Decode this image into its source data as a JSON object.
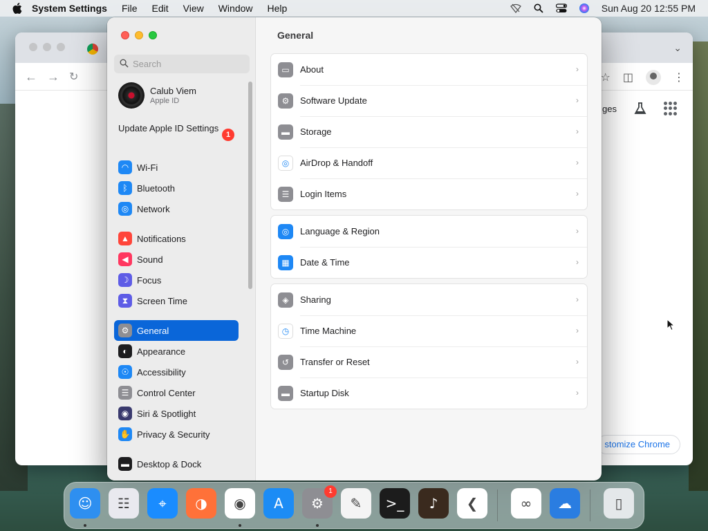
{
  "menubar": {
    "app_name": "System Settings",
    "items": [
      "File",
      "Edit",
      "View",
      "Window",
      "Help"
    ],
    "clock": "Sun Aug 20  12:55 PM",
    "status_icons": [
      "wifi-off-icon",
      "search-icon",
      "control-center-icon",
      "siri-icon"
    ]
  },
  "chrome": {
    "images_link": "ges",
    "customize_label": "stomize Chrome"
  },
  "settings": {
    "search_placeholder": "Search",
    "account": {
      "name": "Calub Viem",
      "sub": "Apple ID"
    },
    "update": {
      "label": "Update Apple ID Settings",
      "badge": "1"
    },
    "sidebar_groups": [
      [
        {
          "label": "Wi-Fi",
          "icon": "wifi-icon",
          "color": "#1e88f5"
        },
        {
          "label": "Bluetooth",
          "icon": "bluetooth-icon",
          "color": "#1e88f5"
        },
        {
          "label": "Network",
          "icon": "globe-icon",
          "color": "#1e88f5"
        }
      ],
      [
        {
          "label": "Notifications",
          "icon": "bell-icon",
          "color": "#ff453a"
        },
        {
          "label": "Sound",
          "icon": "speaker-icon",
          "color": "#ff375f"
        },
        {
          "label": "Focus",
          "icon": "moon-icon",
          "color": "#5e5ce6"
        },
        {
          "label": "Screen Time",
          "icon": "hourglass-icon",
          "color": "#5e5ce6"
        }
      ],
      [
        {
          "label": "General",
          "icon": "gear-icon",
          "color": "#8e8e93",
          "active": true
        },
        {
          "label": "Appearance",
          "icon": "appearance-icon",
          "color": "#1c1c1e"
        },
        {
          "label": "Accessibility",
          "icon": "accessibility-icon",
          "color": "#1e88f5"
        },
        {
          "label": "Control Center",
          "icon": "control-center-icon",
          "color": "#8e8e93"
        },
        {
          "label": "Siri & Spotlight",
          "icon": "siri-icon",
          "color": "#3a3a6e"
        },
        {
          "label": "Privacy & Security",
          "icon": "hand-icon",
          "color": "#1e88f5"
        }
      ],
      [
        {
          "label": "Desktop & Dock",
          "icon": "dock-icon",
          "color": "#1c1c1e"
        }
      ]
    ],
    "content_title": "General",
    "groups": [
      [
        {
          "label": "About",
          "icon": "computer-icon",
          "color": "#8e8e93"
        },
        {
          "label": "Software Update",
          "icon": "gear-badge-icon",
          "color": "#8e8e93"
        },
        {
          "label": "Storage",
          "icon": "drive-icon",
          "color": "#8e8e93"
        },
        {
          "label": "AirDrop & Handoff",
          "icon": "airdrop-icon",
          "color": "#ffffff"
        },
        {
          "label": "Login Items",
          "icon": "list-icon",
          "color": "#8e8e93"
        }
      ],
      [
        {
          "label": "Language & Region",
          "icon": "globe-icon",
          "color": "#1e88f5"
        },
        {
          "label": "Date & Time",
          "icon": "calendar-clock-icon",
          "color": "#1e88f5"
        }
      ],
      [
        {
          "label": "Sharing",
          "icon": "sharing-icon",
          "color": "#8e8e93"
        },
        {
          "label": "Time Machine",
          "icon": "time-machine-icon",
          "color": "#ffffff"
        },
        {
          "label": "Transfer or Reset",
          "icon": "reset-icon",
          "color": "#8e8e93"
        },
        {
          "label": "Startup Disk",
          "icon": "disk-icon",
          "color": "#8e8e93"
        }
      ]
    ]
  },
  "dock": {
    "apps": [
      {
        "name": "finder-icon",
        "color": "#2e8ff0",
        "running": true
      },
      {
        "name": "launchpad-icon",
        "color": "#e9e9ef",
        "running": false
      },
      {
        "name": "safari-icon",
        "color": "#1a8cff",
        "running": false
      },
      {
        "name": "firefox-icon",
        "color": "#ff7139",
        "running": false
      },
      {
        "name": "chrome-icon",
        "color": "#ffffff",
        "running": true
      },
      {
        "name": "app-store-icon",
        "color": "#1c8cf5",
        "running": false
      },
      {
        "name": "system-settings-icon",
        "color": "#8e8e93",
        "running": true,
        "badge": "1"
      },
      {
        "name": "textedit-icon",
        "color": "#f4f4f4",
        "running": false
      },
      {
        "name": "terminal-icon",
        "color": "#1c1c1c",
        "running": false
      },
      {
        "name": "garageband-icon",
        "color": "#3a2a1e",
        "running": false
      },
      {
        "name": "vscode-icon",
        "color": "#ffffff",
        "running": false
      },
      {
        "name": "visual-studio-icon",
        "color": "#ffffff",
        "running": false
      },
      {
        "name": "weather-icon",
        "color": "#2a7de1",
        "running": false
      },
      {
        "name": "trash-icon",
        "color": "#e4e8ea",
        "running": false
      }
    ]
  }
}
